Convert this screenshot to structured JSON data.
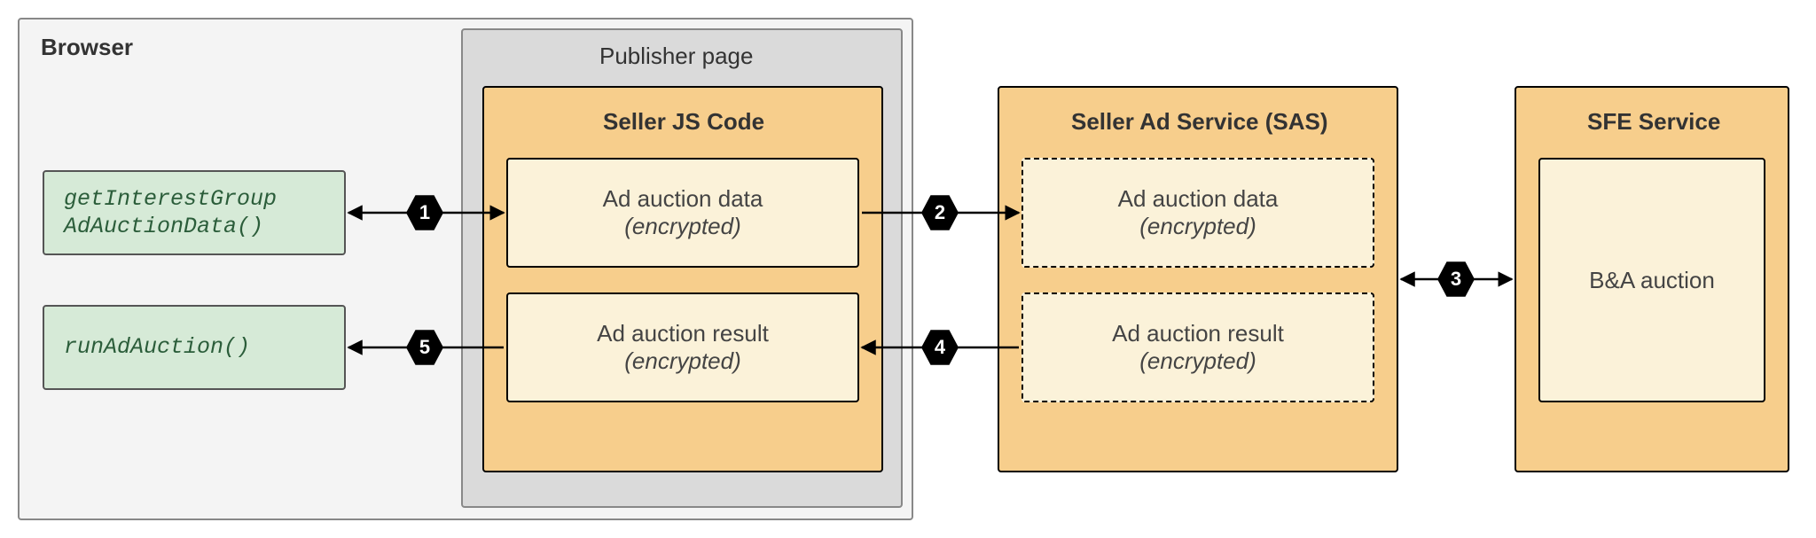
{
  "browser": {
    "label": "Browser"
  },
  "publisher": {
    "label": "Publisher page"
  },
  "seller_js": {
    "label": "Seller JS Code",
    "data": {
      "line1": "Ad auction data",
      "line2": "(encrypted)"
    },
    "result": {
      "line1": "Ad auction result",
      "line2": "(encrypted)"
    }
  },
  "sas": {
    "label": "Seller Ad Service (SAS)",
    "data": {
      "line1": "Ad auction data",
      "line2": "(encrypted)"
    },
    "result": {
      "line1": "Ad auction result",
      "line2": "(encrypted)"
    }
  },
  "sfe": {
    "label": "SFE Service",
    "ba": "B&A auction"
  },
  "api": {
    "getIG": "getInterestGroup AdAuctionData()",
    "run": "runAdAuction()"
  },
  "steps": {
    "s1": "1",
    "s2": "2",
    "s3": "3",
    "s4": "4",
    "s5": "5"
  }
}
